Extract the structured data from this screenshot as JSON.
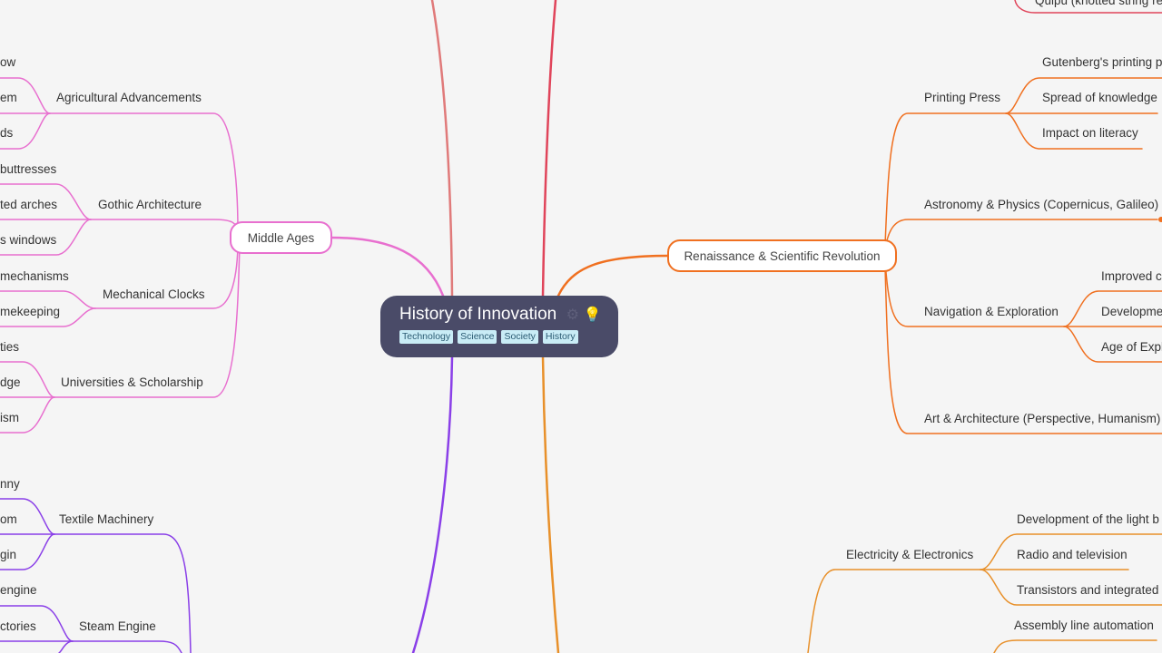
{
  "root": {
    "title": "History of Innovation",
    "icons": [
      "gear-icon",
      "lightbulb-icon"
    ],
    "tags": [
      "Technology",
      "Science",
      "Society",
      "History"
    ]
  },
  "colors": {
    "background": "#f5f5f5",
    "root_fill": "#4a4b68",
    "tag_fill": "#c9ecf6",
    "ancient_top_left": "#e07a7a",
    "ancient_top_right": "#e0445a",
    "middle_ages": "#e86fcf",
    "industrial": "#8a3fe8",
    "renaissance": "#f07020",
    "modern": "#e8902a"
  },
  "branches": {
    "top_right_partial": {
      "children": [
        "Quipu (knotted string re"
      ]
    },
    "middle_ages": {
      "label": "Middle Ages",
      "children": [
        {
          "label": "Agricultural Advancements",
          "children": [
            "ow",
            "em",
            "ds"
          ]
        },
        {
          "label": "Gothic Architecture",
          "children": [
            "buttresses",
            "ted arches",
            "s windows"
          ]
        },
        {
          "label": "Mechanical Clocks",
          "children": [
            "mechanisms",
            "mekeeping"
          ]
        },
        {
          "label": "Universities & Scholarship",
          "children": [
            "ties",
            "dge",
            "ism"
          ]
        }
      ]
    },
    "industrial": {
      "children": [
        {
          "label": "Textile Machinery",
          "children": [
            "nny",
            "om",
            "gin"
          ]
        },
        {
          "label": "Steam Engine",
          "children": [
            "engine",
            "ctories"
          ]
        }
      ]
    },
    "renaissance": {
      "label": "Renaissance & Scientific Revolution",
      "children": [
        {
          "label": "Printing Press",
          "children": [
            "Gutenberg's printing p",
            "Spread of knowledge",
            "Impact on literacy"
          ]
        },
        {
          "label": "Astronomy & Physics (Copernicus, Galileo)",
          "children": []
        },
        {
          "label": "Navigation & Exploration",
          "children": [
            "Improved c",
            "Developme",
            "Age of Explo"
          ]
        },
        {
          "label": "Art & Architecture (Perspective, Humanism)",
          "children": []
        }
      ]
    },
    "modern": {
      "children": [
        {
          "label": "Electricity & Electronics",
          "children": [
            "Development of the light b",
            "Radio and television",
            "Transistors and integrated c"
          ]
        },
        {
          "label": "Assembly line automation"
        }
      ]
    }
  }
}
